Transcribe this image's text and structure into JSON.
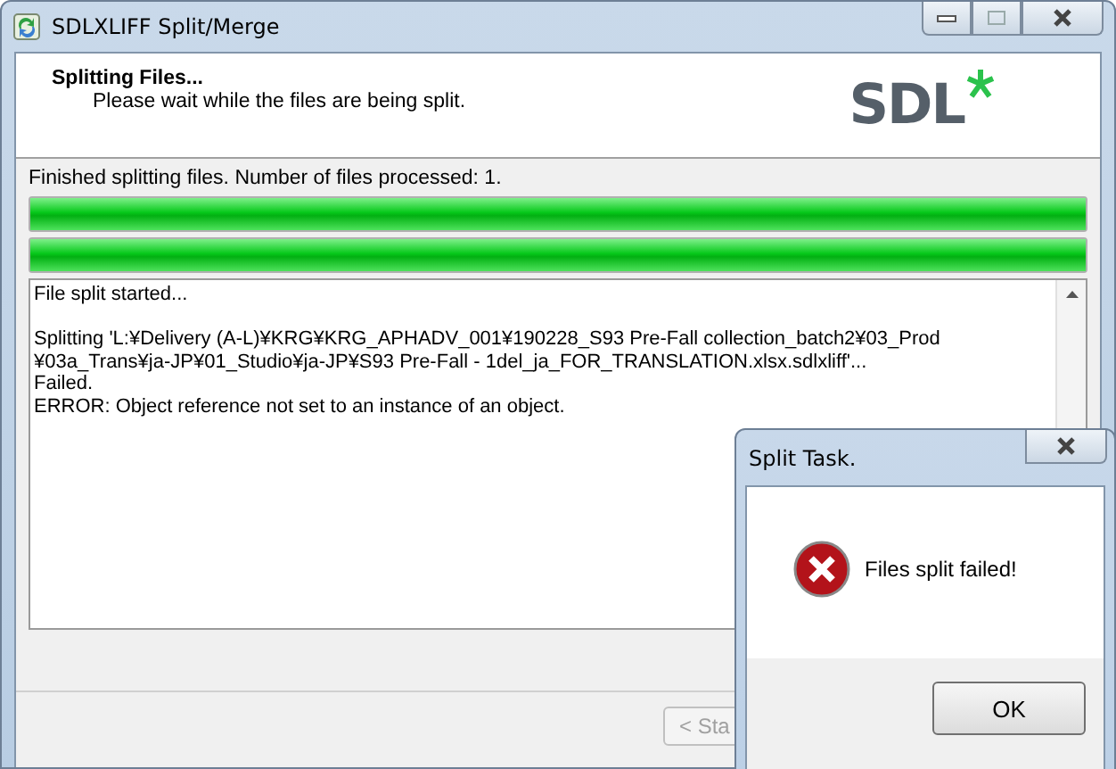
{
  "window": {
    "title": "SDLXLIFF Split/Merge"
  },
  "header": {
    "title": "Splitting Files...",
    "subtitle": "Please wait while the files are being split.",
    "logo": "SDL"
  },
  "status": "Finished splitting files. Number of files processed: 1.",
  "progress": [
    {
      "level": 1
    },
    {
      "level": 1
    }
  ],
  "log": [
    [
      "File split started..."
    ],
    [
      "Splitting 'L:¥Delivery (A-L)¥KRG¥KRG_APHADV_001¥190228_S93 Pre-Fall collection_batch2¥03_Prod",
      "¥03a_Trans¥ja-JP¥01_Studio¥ja-JP¥S93 Pre-Fall - 1del_ja_FOR_TRANSLATION.xlsx.sdlxliff'...",
      "Failed.",
      "ERROR: Object reference not set to an instance of an object."
    ]
  ],
  "back_button": "< Sta",
  "dialog": {
    "title": "Split Task.",
    "message": "Files split failed!",
    "button": "OK"
  }
}
